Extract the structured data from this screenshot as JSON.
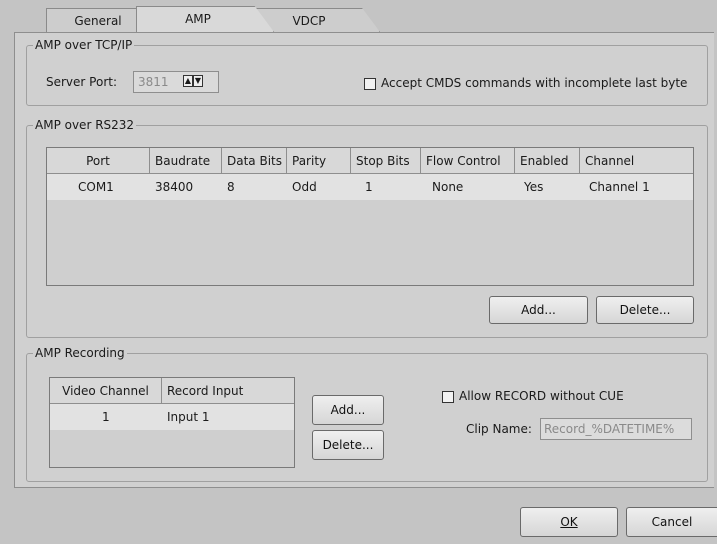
{
  "tabs": [
    "General",
    "AMP",
    "VDCP"
  ],
  "active_tab": "AMP",
  "tcp": {
    "legend": "AMP over TCP/IP",
    "server_port_label": "Server Port:",
    "server_port_value": "3811",
    "accept_cmds_label": "Accept CMDS commands with incomplete last byte",
    "accept_cmds_checked": false
  },
  "rs232": {
    "legend": "AMP over RS232",
    "columns": [
      "Port",
      "Baudrate",
      "Data Bits",
      "Parity",
      "Stop Bits",
      "Flow Control",
      "Enabled",
      "Channel"
    ],
    "rows": [
      [
        "COM1",
        "38400",
        "8",
        "Odd",
        "1",
        "None",
        "Yes",
        "Channel 1"
      ]
    ],
    "add_label": "Add...",
    "delete_label": "Delete..."
  },
  "recording": {
    "legend": "AMP Recording",
    "columns": [
      "Video Channel",
      "Record Input"
    ],
    "rows": [
      [
        "1",
        "Input 1"
      ]
    ],
    "add_label": "Add...",
    "delete_label": "Delete...",
    "allow_record_label": "Allow RECORD without CUE",
    "allow_record_checked": false,
    "clip_name_label": "Clip Name:",
    "clip_name_value": "Record_%DATETIME%"
  },
  "footer": {
    "ok_label": "OK",
    "cancel_label": "Cancel"
  }
}
